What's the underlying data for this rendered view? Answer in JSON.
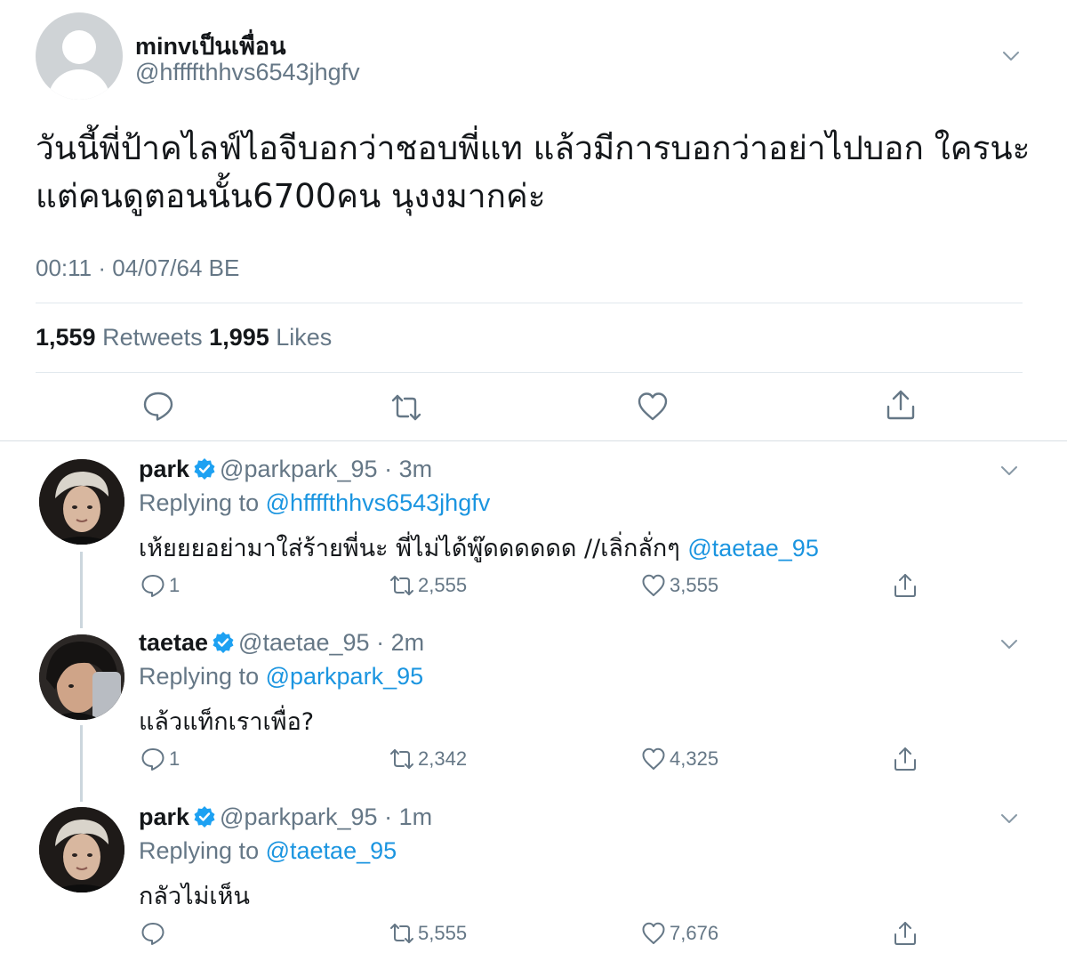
{
  "main_tweet": {
    "display_name": "minvเป็นเพื่อน",
    "handle": "@hffffthhvs6543jhgfv",
    "text": "วันนี้พี่ป้าคไลฟ์ไอจีบอกว่าชอบพี่แท แล้วมีการบอกว่าอย่าไปบอก ใครนะแต่คนดูตอนนั้น6700คน นุงงมากค่ะ",
    "timestamp": "00:11 · 04/07/64 BE",
    "retweets_count": "1,559",
    "retweets_label": "Retweets",
    "likes_count": "1,995",
    "likes_label": "Likes",
    "icons": [
      "reply-icon",
      "retweet-icon",
      "like-icon",
      "share-icon",
      "chevron-down-icon"
    ]
  },
  "replies": [
    {
      "display_name": "park",
      "handle": "@parkpark_95",
      "time": "· 3m",
      "replying_label": "Replying to",
      "replying_to": "@hffffthhvs6543jhgfv",
      "text": "เห้ยยยอย่ามาใส่ร้ายพี่นะ พี่ไม่ได้พู๊ดดดดดด //เลิ่กลั่กๆ",
      "mention": "@taetae_95",
      "reply_count": "1",
      "retweet_count": "2,555",
      "like_count": "3,555"
    },
    {
      "display_name": "taetae",
      "handle": "@taetae_95",
      "time": "· 2m",
      "replying_label": "Replying to",
      "replying_to": "@parkpark_95",
      "text": "แล้วแท็กเราเพื่อ?",
      "mention": "",
      "reply_count": "1",
      "retweet_count": "2,342",
      "like_count": "4,325"
    },
    {
      "display_name": "park",
      "handle": "@parkpark_95",
      "time": "· 1m",
      "replying_label": "Replying to",
      "replying_to": "@taetae_95",
      "text": "กลัวไม่เห็น",
      "mention": "",
      "reply_count": "",
      "retweet_count": "5,555",
      "like_count": "7,676"
    }
  ],
  "colors": {
    "link": "#1b95e0",
    "secondary_text": "#657786",
    "primary_text": "#14171a",
    "verified": "#1da1f2",
    "divider": "#e1e8ed"
  }
}
